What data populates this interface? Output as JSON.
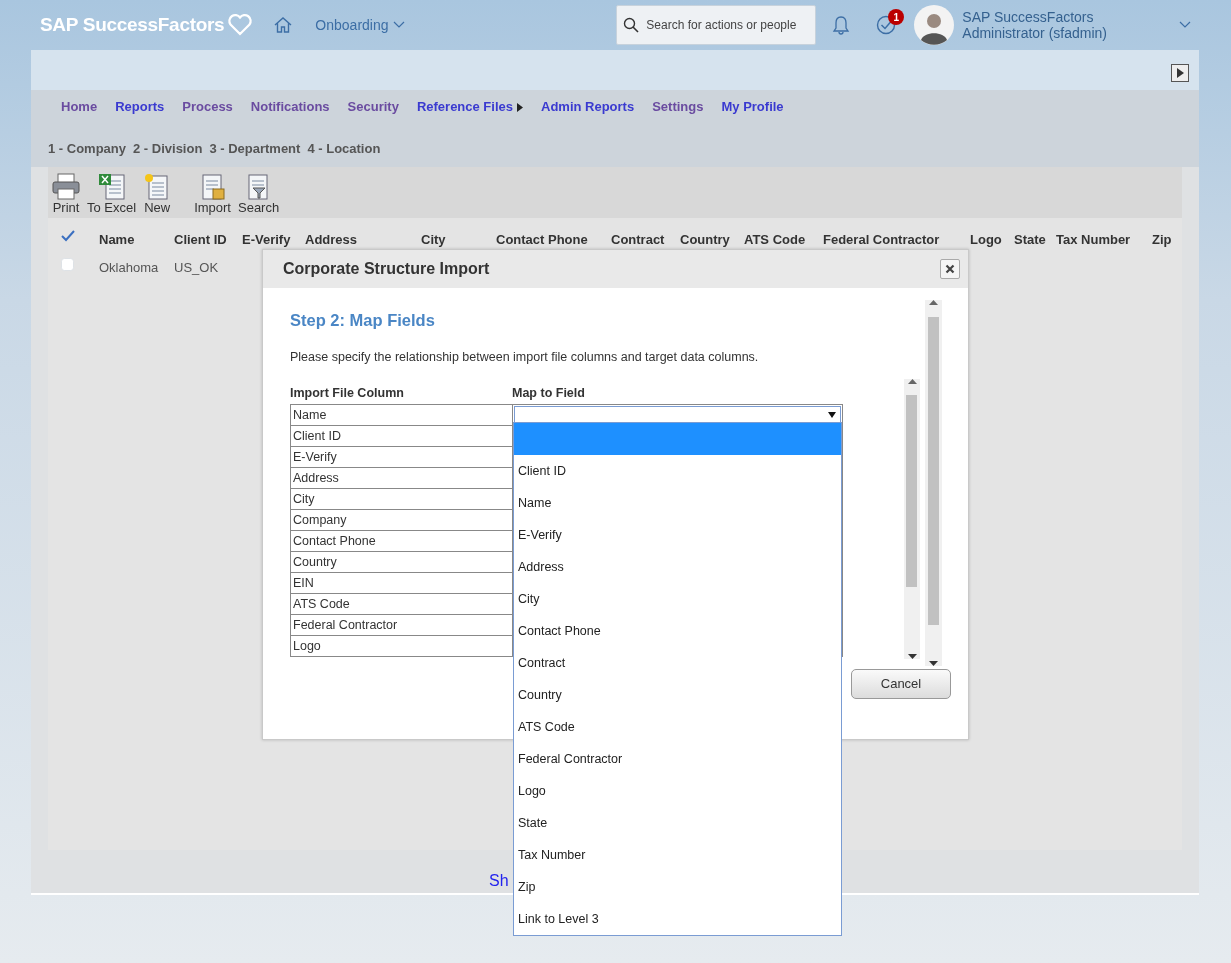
{
  "header": {
    "logo": "SAP SuccessFactors",
    "module": "Onboarding",
    "search": {
      "placeholder": "Search for actions or people"
    },
    "notification_badge": "1",
    "user": {
      "name": "SAP SuccessFactors",
      "role": "Administrator (sfadmin)"
    }
  },
  "nav": [
    {
      "label": "Home",
      "visited": true
    },
    {
      "label": "Reports",
      "visited": false
    },
    {
      "label": "Process",
      "visited": true
    },
    {
      "label": "Notifications",
      "visited": true
    },
    {
      "label": "Security",
      "visited": true
    },
    {
      "label": "Reference Files",
      "visited": false,
      "submenu": true
    },
    {
      "label": "Admin Reports",
      "visited": false
    },
    {
      "label": "Settings",
      "visited": true
    },
    {
      "label": "My Profile",
      "visited": false
    }
  ],
  "levels": [
    "1 - Company",
    "2 - Division",
    "3 - Department",
    "4 - Location"
  ],
  "toolbar": [
    {
      "label": "Print",
      "kind": "print"
    },
    {
      "label": "To Excel",
      "kind": "excel"
    },
    {
      "label": "New",
      "kind": "new"
    },
    {
      "label": "Import",
      "kind": "import"
    },
    {
      "label": "Search",
      "kind": "search"
    }
  ],
  "table": {
    "columns": [
      "Name",
      "Client ID",
      "E-Verify",
      "Address",
      "City",
      "Contact Phone",
      "Contract",
      "Country",
      "ATS Code",
      "Federal Contractor",
      "Logo",
      "State",
      "Tax Number",
      "Zip"
    ],
    "rows": [
      {
        "checked": false,
        "cells": [
          "Oklahoma",
          "US_OK"
        ]
      }
    ]
  },
  "dialog": {
    "title": "Corporate Structure Import",
    "step_title": "Step 2: Map Fields",
    "instructions": "Please specify the relationship between import file columns and target data columns.",
    "columns": [
      "Import File Column",
      "Map to Field"
    ],
    "rows": [
      "Name",
      "Client ID",
      "E-Verify",
      "Address",
      "City",
      "Company",
      "Contact Phone",
      "Country",
      "EIN",
      "ATS Code",
      "Federal Contractor",
      "Logo"
    ],
    "dropdown": {
      "options": [
        {
          "selected": true
        },
        {
          "label": "Client ID",
          "selected": false
        },
        {
          "label": "Name",
          "selected": false
        },
        {
          "label": "E-Verify",
          "selected": false
        },
        {
          "label": "Address",
          "selected": false
        },
        {
          "label": "City",
          "selected": false
        },
        {
          "label": "Contact Phone",
          "selected": false
        },
        {
          "label": "Contract",
          "selected": false
        },
        {
          "label": "Country",
          "selected": false
        },
        {
          "label": "ATS Code",
          "selected": false
        },
        {
          "label": "Federal Contractor",
          "selected": false
        },
        {
          "label": "Logo",
          "selected": false
        },
        {
          "label": "State",
          "selected": false
        },
        {
          "label": "Tax Number",
          "selected": false
        },
        {
          "label": "Zip",
          "selected": false
        },
        {
          "label": "Link to Level 3",
          "selected": false
        }
      ]
    },
    "buttons": [
      "Cancel"
    ]
  },
  "footer_link": "Sh"
}
